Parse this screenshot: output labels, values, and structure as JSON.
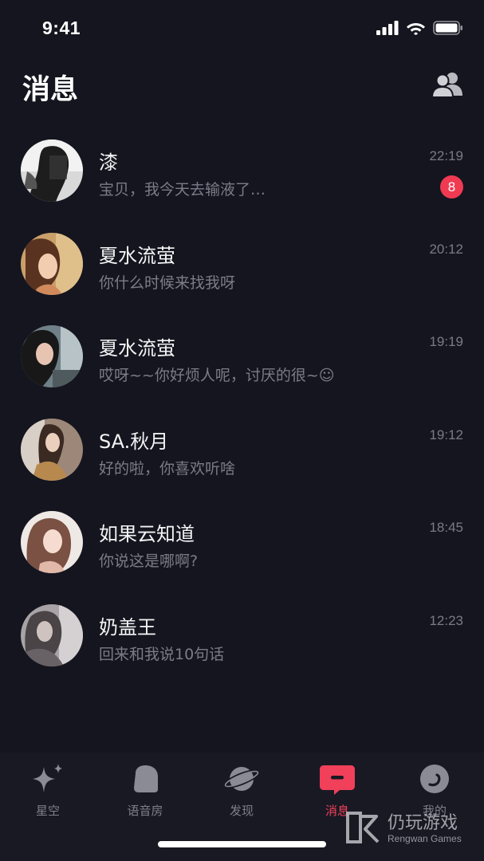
{
  "status_bar": {
    "time": "9:41"
  },
  "header": {
    "title": "消息"
  },
  "messages": [
    {
      "name": "漆",
      "preview": "宝贝，我今天去输液了…",
      "time": "22:19",
      "unread": "8"
    },
    {
      "name": "夏水流萤",
      "preview": "你什么时候来找我呀",
      "time": "20:12"
    },
    {
      "name": "夏水流萤",
      "preview": "哎呀~~你好烦人呢，讨厌的很~☺",
      "time": "19:19"
    },
    {
      "name": "SA.秋月",
      "preview": "好的啦，你喜欢听啥",
      "time": "19:12"
    },
    {
      "name": "如果云知道",
      "preview": "你说这是哪啊?",
      "time": "18:45"
    },
    {
      "name": "奶盖王",
      "preview": "回来和我说10句话",
      "time": "12:23"
    }
  ],
  "tab_bar": {
    "active_color": "#f0405a",
    "tabs": [
      {
        "label": "星空",
        "icon": "sparkle-icon"
      },
      {
        "label": "语音房",
        "icon": "voice-room-icon"
      },
      {
        "label": "发现",
        "icon": "planet-icon"
      },
      {
        "label": "消息",
        "icon": "message-icon",
        "active": true
      },
      {
        "label": "我的",
        "icon": "profile-icon"
      }
    ]
  },
  "watermark": {
    "title": "仍玩游戏",
    "subtitle": "Rengwan Games"
  }
}
